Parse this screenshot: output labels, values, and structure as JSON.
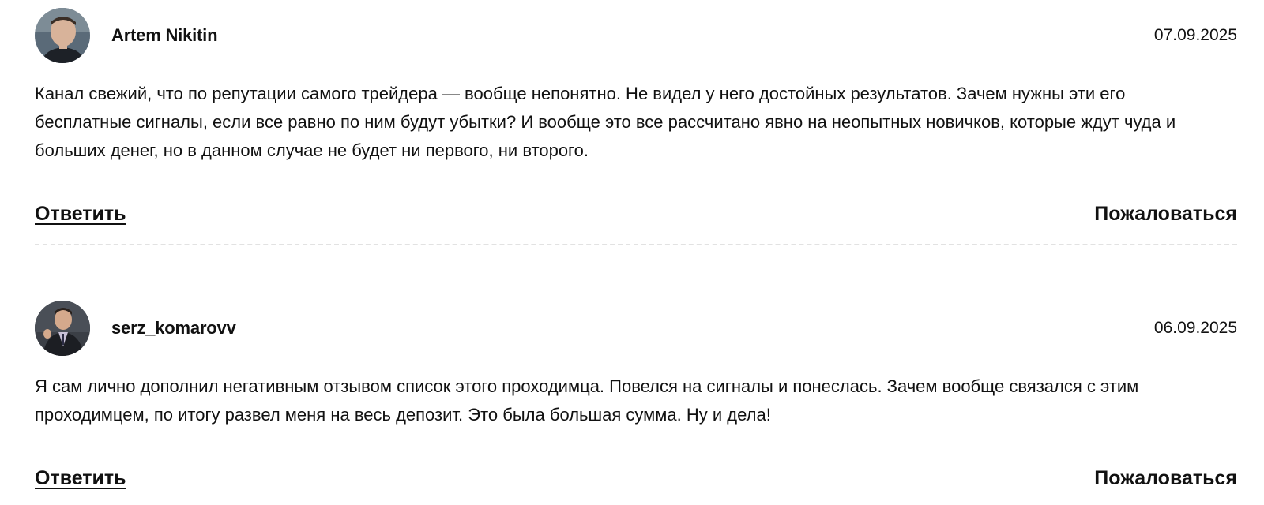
{
  "comments": [
    {
      "author": "Artem Nikitin",
      "date": "07.09.2025",
      "text": "Канал свежий, что по репутации самого трейдера — вообще непонятно. Не видел у него достойных результатов. Зачем нужны эти его бесплатные сигналы, если все равно по ним будут убытки? И вообще это все рассчитано явно на неопытных новичков, которые ждут чуда и больших денег, но в данном случае не будет ни первого, ни второго.",
      "reply_label": "Ответить",
      "complain_label": "Пожаловаться"
    },
    {
      "author": "serz_komarovv",
      "date": "06.09.2025",
      "text": "Я сам лично дополнил негативным отзывом список этого проходимца. Повелся на сигналы и понеслась. Зачем вообще связался с этим проходимцем, по итогу развел меня на весь депозит. Это была большая сумма. Ну и дела!",
      "reply_label": "Ответить",
      "complain_label": "Пожаловаться"
    }
  ],
  "colors": {
    "text": "#111111",
    "divider": "#e2e2e2",
    "background": "#ffffff"
  }
}
